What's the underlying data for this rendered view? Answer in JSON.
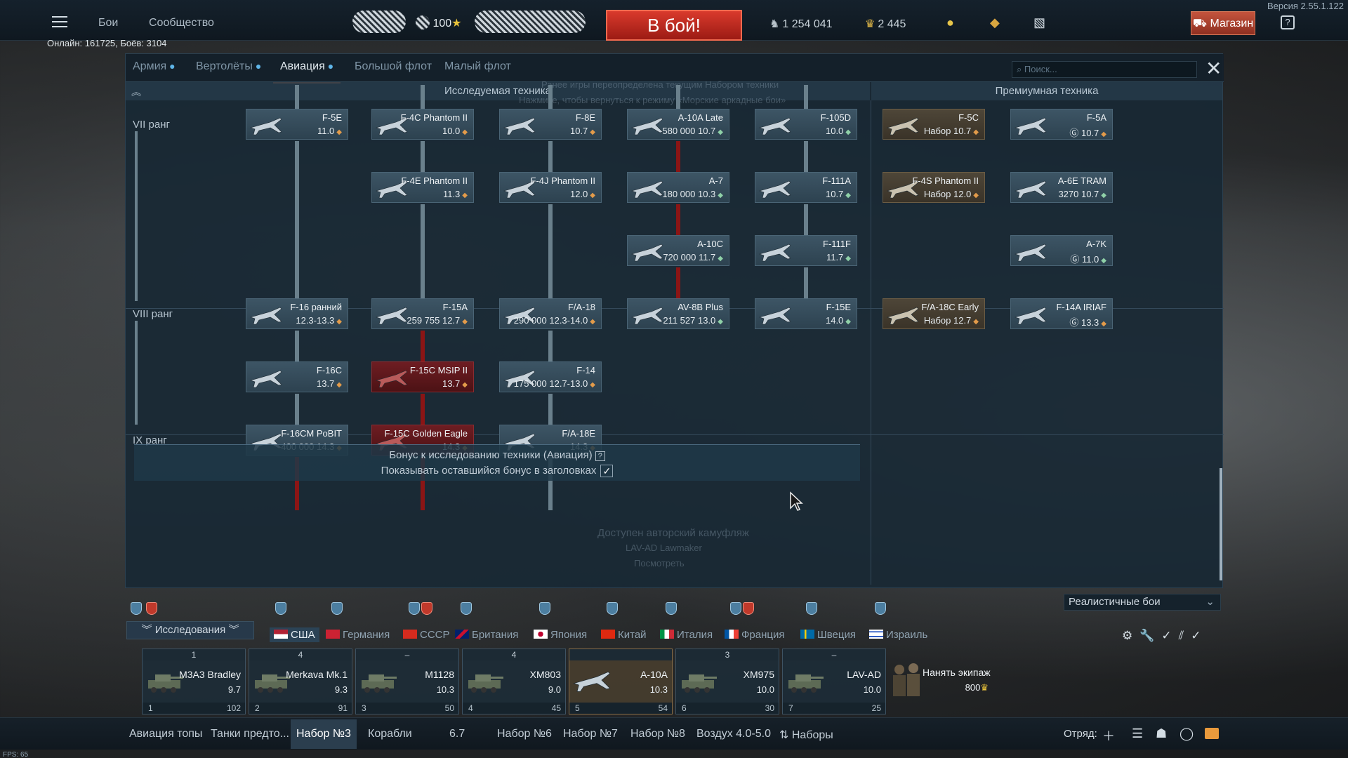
{
  "app": {
    "version": "Версия 2.55.1.122",
    "online": "Онлайн: 161725, Боёв: 3104",
    "fps": "FPS: 65"
  },
  "topbar": {
    "nav": [
      "Бои",
      "Сообщество"
    ],
    "level": "100",
    "battle_button": "В бой!",
    "silver_lions": "1 254 041",
    "golden_eagles": "2 445",
    "shop": "Магазин",
    "help": "?"
  },
  "window": {
    "tabs": [
      {
        "label": "Армия",
        "active": false
      },
      {
        "label": "Вертолёты",
        "active": false
      },
      {
        "label": "Авиация",
        "active": true
      },
      {
        "label": "Большой флот",
        "active": false
      },
      {
        "label": "Малый флот",
        "active": false
      }
    ],
    "search_placeholder": "Поиск...",
    "section_researched": "Исследуемая техника",
    "section_premium": "Премиумная техника",
    "ghost_top_1": "Ранее игры переопределена текущим Набором техники",
    "ghost_top_2": "Нажмите, чтобы вернуться к режиму «Морские аркадные бои»",
    "ranks": [
      "VII ранг",
      "VIII ранг",
      "IX ранг"
    ],
    "bonus_text": "Бонус к исследованию техники (Авиация)",
    "bonus_show": "Показывать оставшийся бонус в заголовках",
    "ghost_camo": "Доступен авторский камуфляж",
    "ghost_vehicle": "LAV-AD Lawmaker",
    "ghost_view": "Посмотреть"
  },
  "vehicles": [
    {
      "id": "f5e",
      "name": "F-5E",
      "br": "11.0",
      "type": "tree",
      "dot": "o"
    },
    {
      "id": "f4c",
      "name": "F-4C Phantom II",
      "br": "10.0",
      "type": "tree",
      "dot": "o"
    },
    {
      "id": "f8e",
      "name": "F-8E",
      "br": "10.7",
      "type": "tree",
      "dot": "o"
    },
    {
      "id": "a10late",
      "name": "A-10A Late",
      "cost": "580 000",
      "br": "10.7",
      "type": "tree",
      "dot": "g"
    },
    {
      "id": "f105d",
      "name": "F-105D",
      "br": "10.0",
      "type": "tree",
      "dot": "g"
    },
    {
      "id": "f5c",
      "name": "F-5C",
      "cost": "Набор",
      "br": "10.7",
      "type": "prem",
      "dot": "o"
    },
    {
      "id": "f5a",
      "name": "F-5A",
      "cost": "Ⓖ",
      "br": "10.7",
      "type": "prem2",
      "dot": "o"
    },
    {
      "id": "f4e",
      "name": "F-4E Phantom II",
      "br": "11.3",
      "type": "tree",
      "dot": "o"
    },
    {
      "id": "f4j",
      "name": "F-4J Phantom II",
      "br": "12.0",
      "type": "tree",
      "dot": "o"
    },
    {
      "id": "a7",
      "name": "A-7",
      "cost": "180 000",
      "br": "10.3",
      "type": "tree",
      "dot": "g"
    },
    {
      "id": "f111a",
      "name": "F-111A",
      "br": "10.7",
      "type": "tree",
      "dot": "g"
    },
    {
      "id": "f4s",
      "name": "F-4S Phantom II",
      "cost": "Набор",
      "br": "12.0",
      "type": "prem",
      "dot": "o"
    },
    {
      "id": "a6e",
      "name": "A-6E TRAM",
      "cost": "3270",
      "br": "10.7",
      "type": "prem2",
      "dot": "g"
    },
    {
      "id": "a10c",
      "name": "A-10C",
      "cost": "720 000",
      "br": "11.7",
      "type": "tree",
      "dot": "g"
    },
    {
      "id": "f111f",
      "name": "F-111F",
      "br": "11.7",
      "type": "tree",
      "dot": "g"
    },
    {
      "id": "a7k",
      "name": "A-7K",
      "cost": "Ⓖ",
      "br": "11.0",
      "type": "prem2",
      "dot": "g"
    },
    {
      "id": "f16early",
      "name": "F-16 ранний",
      "br": "12.3-13.3",
      "type": "tree",
      "dot": "o"
    },
    {
      "id": "f15a",
      "name": "F-15A",
      "cost": "259 755",
      "br": "12.7",
      "type": "tree",
      "dot": "o"
    },
    {
      "id": "fa18",
      "name": "F/A-18",
      "cost": "290 000",
      "br": "12.3-14.0",
      "type": "tree",
      "dot": "o"
    },
    {
      "id": "av8b",
      "name": "AV-8B Plus",
      "cost": "211 527",
      "br": "13.0",
      "type": "tree",
      "dot": "g"
    },
    {
      "id": "f15e",
      "name": "F-15E",
      "br": "14.0",
      "type": "tree",
      "dot": "g"
    },
    {
      "id": "fa18cearly",
      "name": "F/A-18C Early",
      "cost": "Набор",
      "br": "12.7",
      "type": "prem",
      "dot": "o"
    },
    {
      "id": "f14airiaf",
      "name": "F-14A IRIAF",
      "cost": "Ⓖ",
      "br": "13.3",
      "type": "prem2",
      "dot": "o"
    },
    {
      "id": "f16c",
      "name": "F-16C",
      "br": "13.7",
      "type": "tree",
      "dot": "o"
    },
    {
      "id": "f15cmsip",
      "name": "F-15C MSIP II",
      "br": "13.7",
      "type": "squad",
      "dot": "o"
    },
    {
      "id": "f14",
      "name": "F-14",
      "cost": "175 000",
      "br": "12.7-13.0",
      "type": "tree",
      "dot": "o"
    },
    {
      "id": "f16cm",
      "name": "F-16CM PoBIT",
      "cost": "400 000",
      "br": "14.3",
      "type": "tree",
      "dot": "o"
    },
    {
      "id": "f15cge",
      "name": "F-15C Golden Eagle",
      "br": "14.3",
      "type": "squad",
      "dot": "o"
    },
    {
      "id": "fa18e",
      "name": "F/A-18E",
      "br": "14.3",
      "type": "tree",
      "dot": "o"
    }
  ],
  "game_mode": "Реалистичные бои",
  "research_dropdown": "Исследования",
  "nations": [
    {
      "label": "США",
      "active": true
    },
    {
      "label": "Германия",
      "active": false
    },
    {
      "label": "СССР",
      "active": false
    },
    {
      "label": "Британия",
      "active": false
    },
    {
      "label": "Япония",
      "active": false
    },
    {
      "label": "Китай",
      "active": false
    },
    {
      "label": "Италия",
      "active": false
    },
    {
      "label": "Франция",
      "active": false
    },
    {
      "label": "Швеция",
      "active": false
    },
    {
      "label": "Израиль",
      "active": false
    }
  ],
  "crew_slots": [
    {
      "rank": "1",
      "name": "M3A3 Bradley",
      "br": "9.7",
      "num": "1",
      "val": "102"
    },
    {
      "rank": "4",
      "name": "Merkava Mk.1",
      "br": "9.3",
      "num": "2",
      "val": "91"
    },
    {
      "rank": "–",
      "name": "M1128",
      "br": "10.3",
      "num": "3",
      "val": "50"
    },
    {
      "rank": "4",
      "name": "XM803",
      "br": "9.0",
      "num": "4",
      "val": "45"
    },
    {
      "rank": "",
      "name": "A-10A",
      "br": "10.3",
      "num": "5",
      "val": "54"
    },
    {
      "rank": "3",
      "name": "XM975",
      "br": "10.0",
      "num": "6",
      "val": "30"
    },
    {
      "rank": "–",
      "name": "LAV-AD",
      "br": "10.0",
      "num": "7",
      "val": "25"
    }
  ],
  "hire_crew": {
    "label": "Нанять экипаж",
    "cost": "800"
  },
  "presets": [
    "Авиация топы",
    "Танки предто...",
    "Набор №3",
    "Корабли",
    "6.7",
    "Набор №6",
    "Набор №7",
    "Набор №8",
    "Воздух 4.0-5.0",
    "Наборы"
  ],
  "squad_label": "Отряд:",
  "colors": {
    "accent": "#d8733f",
    "battle": "#c52a20",
    "premium": "#4e4638",
    "squadron": "#6e1d22"
  }
}
